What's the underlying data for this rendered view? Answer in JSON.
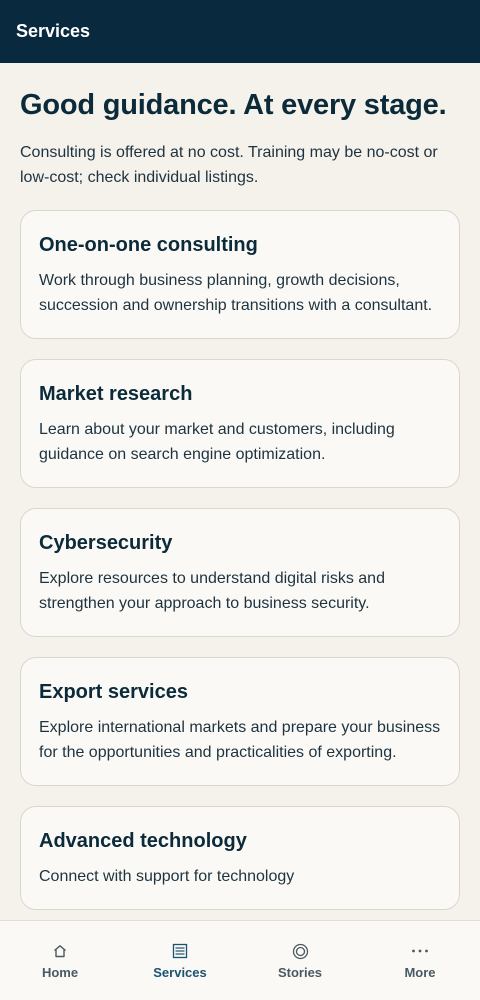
{
  "topbar": {
    "title": "Services"
  },
  "main": {
    "headline": "Good guidance. At every stage.",
    "intro": "Consulting is offered at no cost. Training may be no-cost or low-cost; check individual listings.",
    "cards": [
      {
        "title": "One-on-one consulting",
        "text": "Work through business planning, growth decisions, succession and ownership transitions with a consultant."
      },
      {
        "title": "Market research",
        "text": "Learn about your market and customers, including guidance on search engine optimization."
      },
      {
        "title": "Cybersecurity",
        "text": "Explore resources to understand digital risks and strengthen your approach to business security."
      },
      {
        "title": "Export services",
        "text": "Explore international markets and prepare your business for the opportunities and practicalities of exporting."
      },
      {
        "title": "Advanced technology",
        "text": "Connect with support for technology"
      }
    ]
  },
  "tabbar": {
    "active": "Services",
    "tabs": [
      {
        "label": "Home",
        "icon": "home-icon"
      },
      {
        "label": "Services",
        "icon": "list-icon"
      },
      {
        "label": "Stories",
        "icon": "target-icon"
      },
      {
        "label": "More",
        "icon": "more-dots-icon"
      }
    ]
  },
  "colors": {
    "topbar": "#092a3e",
    "background": "#f5f1eb",
    "card": "#fbf9f5",
    "active_tab": "#1b5470",
    "text": "#0b2a3a"
  }
}
